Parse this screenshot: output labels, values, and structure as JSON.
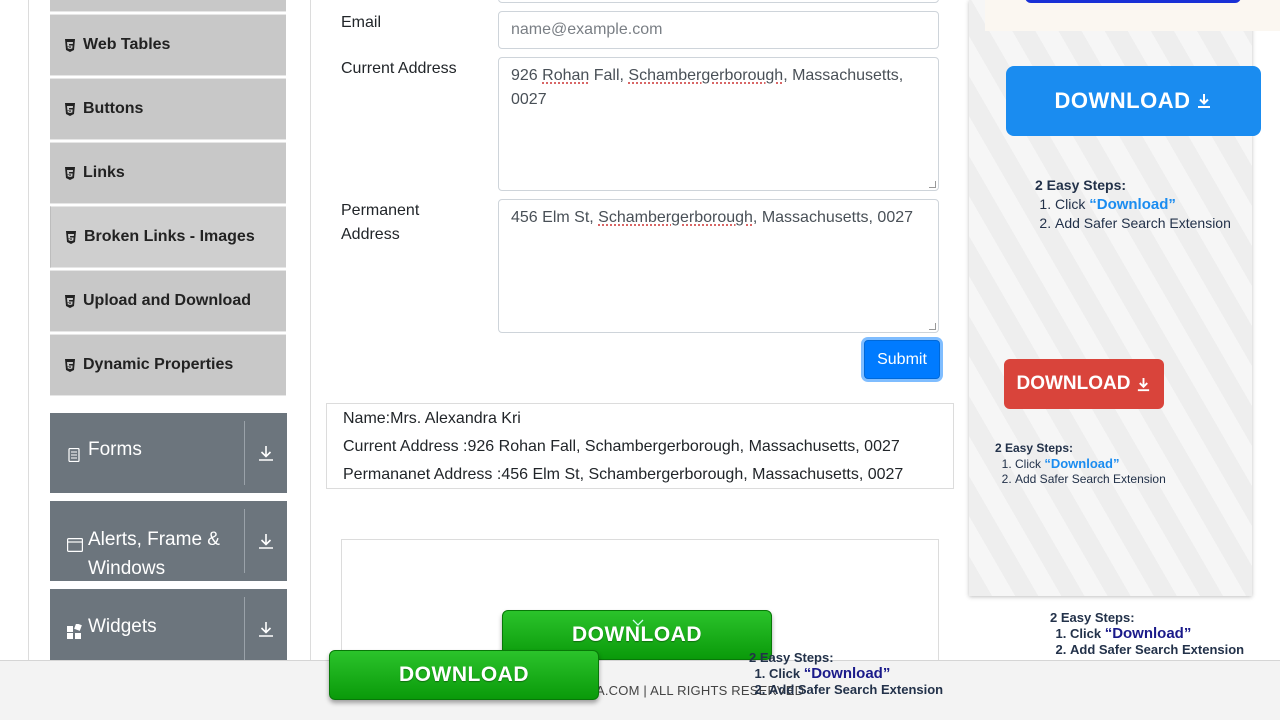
{
  "sidebar": {
    "elements_items": [
      {
        "label": "Web Tables"
      },
      {
        "label": "Buttons"
      },
      {
        "label": "Links"
      },
      {
        "label": "Broken Links - Images"
      },
      {
        "label": "Upload and Download"
      },
      {
        "label": "Dynamic Properties"
      }
    ],
    "groups": [
      {
        "label": "Forms"
      },
      {
        "label": "Alerts, Frame & Windows"
      },
      {
        "label": "Widgets"
      }
    ]
  },
  "form": {
    "email_label": "Email",
    "email_placeholder": "name@example.com",
    "current_address_label": "Current Address",
    "current_address_value": {
      "p1": "926 ",
      "w1": "Rohan",
      "p2": " Fall, ",
      "w2": "Schambergerborough",
      "p3": ", Massachusetts, 0027"
    },
    "permanent_address_label": "Permanent Address",
    "permanent_address_value": {
      "p1": "456 Elm St, ",
      "w1": "Schambergerborough",
      "p2": ", Massachusetts, 0027"
    },
    "submit_label": "Submit"
  },
  "output": {
    "name": "Name:Mrs. Alexandra Kri",
    "current_address": "Current Address :926 Rohan Fall, Schambergerborough, Massachusetts, 0027",
    "permanent_address": "Permananet Address :456 Elm St, Schambergerborough, Massachusetts, 0027"
  },
  "ads": {
    "download_label": "DOWNLOAD",
    "steps_title": "2 Easy Steps:",
    "step1_prefix": "Click ",
    "step1_quote": "“Download”",
    "step2": "Add Safer Search Extension",
    "colors": {
      "blue": "#1a8cf0",
      "red": "#d9443b",
      "green": "#1aaf1a"
    }
  },
  "footer": {
    "text": "A.COM | ALL RIGHTS RESERVED"
  }
}
